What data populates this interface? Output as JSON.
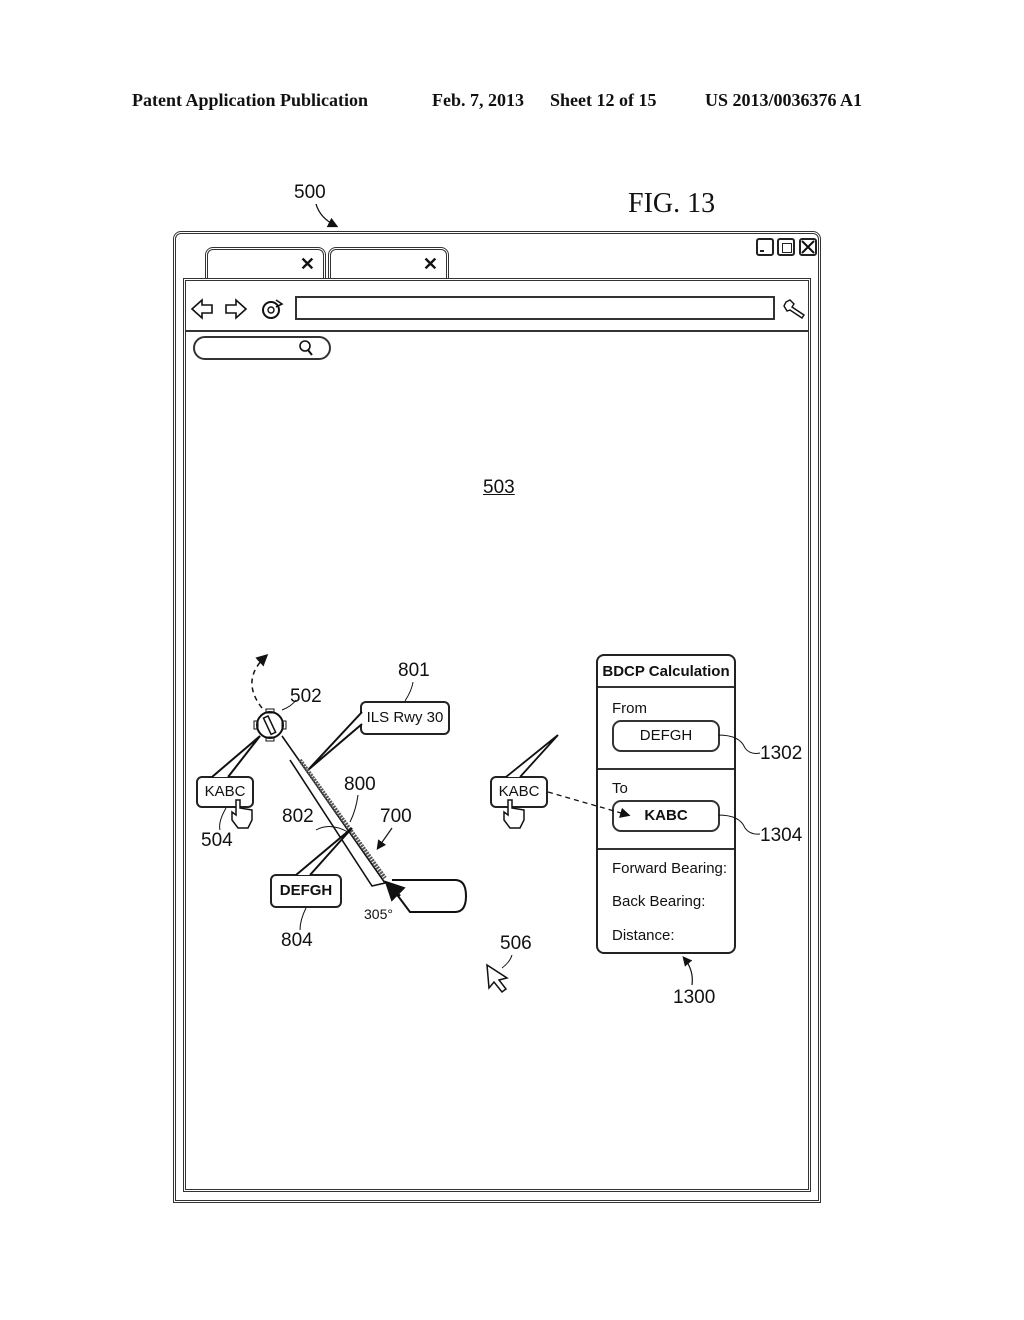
{
  "header": {
    "publication": "Patent Application Publication",
    "date": "Feb. 7, 2013",
    "sheet": "Sheet 12 of 15",
    "number": "US 2013/0036376 A1"
  },
  "figure_label": "FIG. 13",
  "refs": {
    "window": "500",
    "content": "503",
    "icon": "502",
    "kabc_label": "504",
    "cursor": "506",
    "route": "700",
    "line": "800",
    "ils": "801",
    "junction": "802",
    "defgh_label": "804",
    "panel": "1300",
    "from_field": "1302",
    "to_field": "1304"
  },
  "browser": {
    "tabs": [
      {
        "close": "✕"
      },
      {
        "close": "✕"
      }
    ],
    "url_value": "",
    "search_value": ""
  },
  "map": {
    "kabc_left": "KABC",
    "kabc_drag": "KABC",
    "ils": "ILS Rwy 30",
    "defgh": "DEFGH",
    "heading": "305°"
  },
  "panel": {
    "title": "BDCP Calculation",
    "from_label": "From",
    "from_value": "DEFGH",
    "to_label": "To",
    "to_value": "KABC",
    "forward_bearing": "Forward Bearing:",
    "back_bearing": "Back Bearing:",
    "distance": "Distance:"
  }
}
